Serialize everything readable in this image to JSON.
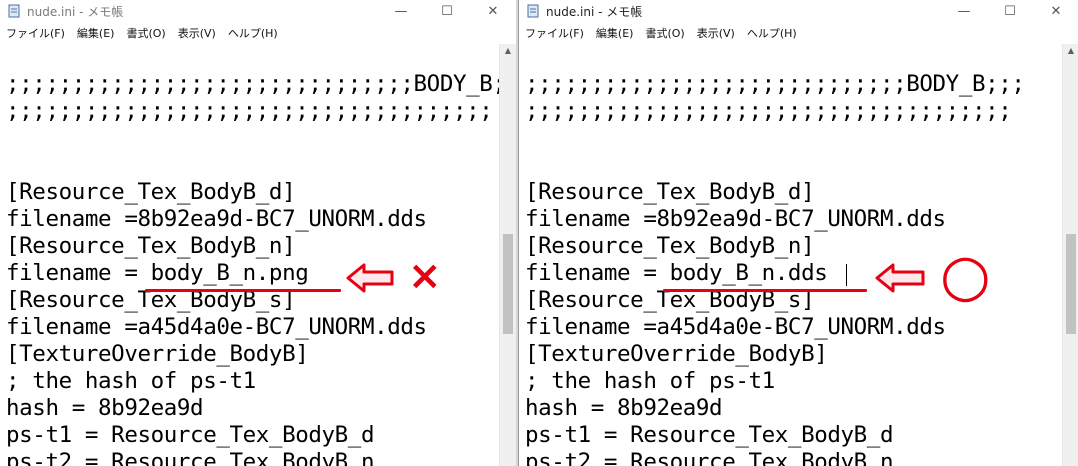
{
  "left": {
    "title": "nude.ini - メモ帳",
    "menu": [
      "ファイル(F)",
      "編集(E)",
      "書式(O)",
      "表示(V)",
      "ヘルプ(H)"
    ],
    "lines": [
      ";;;;;;;;;;;;;;;;;;;;;;;;;;;;;;;BODY_B;",
      ";;;;;;;;;;;;;;;;;;;;;;;;;;;;;;;;;;;;;",
      "",
      "",
      "[Resource_Tex_BodyB_d]",
      "filename =8b92ea9d-BC7_UNORM.dds",
      "[Resource_Tex_BodyB_n]",
      "filename = body_B_n.png",
      "[Resource_Tex_BodyB_s]",
      "filename =a45d4a0e-BC7_UNORM.dds",
      "[TextureOverride_BodyB]",
      "; the hash of ps-t1",
      "hash = 8b92ea9d",
      "ps-t1 = Resource_Tex_BodyB_d",
      "ps-t2 = Resource_Tex_BodyB_n"
    ],
    "mark": "×"
  },
  "right": {
    "title": "nude.ini - メモ帳",
    "menu": [
      "ファイル(F)",
      "編集(E)",
      "書式(O)",
      "表示(V)",
      "ヘルプ(H)"
    ],
    "lines": [
      ";;;;;;;;;;;;;;;;;;;;;;;;;;;;;BODY_B;;;",
      ";;;;;;;;;;;;;;;;;;;;;;;;;;;;;;;;;;;;;",
      "",
      "",
      "[Resource_Tex_BodyB_d]",
      "filename =8b92ea9d-BC7_UNORM.dds",
      "[Resource_Tex_BodyB_n]",
      "filename = body_B_n.dds",
      "[Resource_Tex_BodyB_s]",
      "filename =a45d4a0e-BC7_UNORM.dds",
      "[TextureOverride_BodyB]",
      "; the hash of ps-t1",
      "hash = 8b92ea9d",
      "ps-t1 = Resource_Tex_BodyB_d",
      "ps-t2 = Resource_Tex_BodyB_n"
    ],
    "mark": "○"
  },
  "colors": {
    "annotation": "#e60012"
  }
}
